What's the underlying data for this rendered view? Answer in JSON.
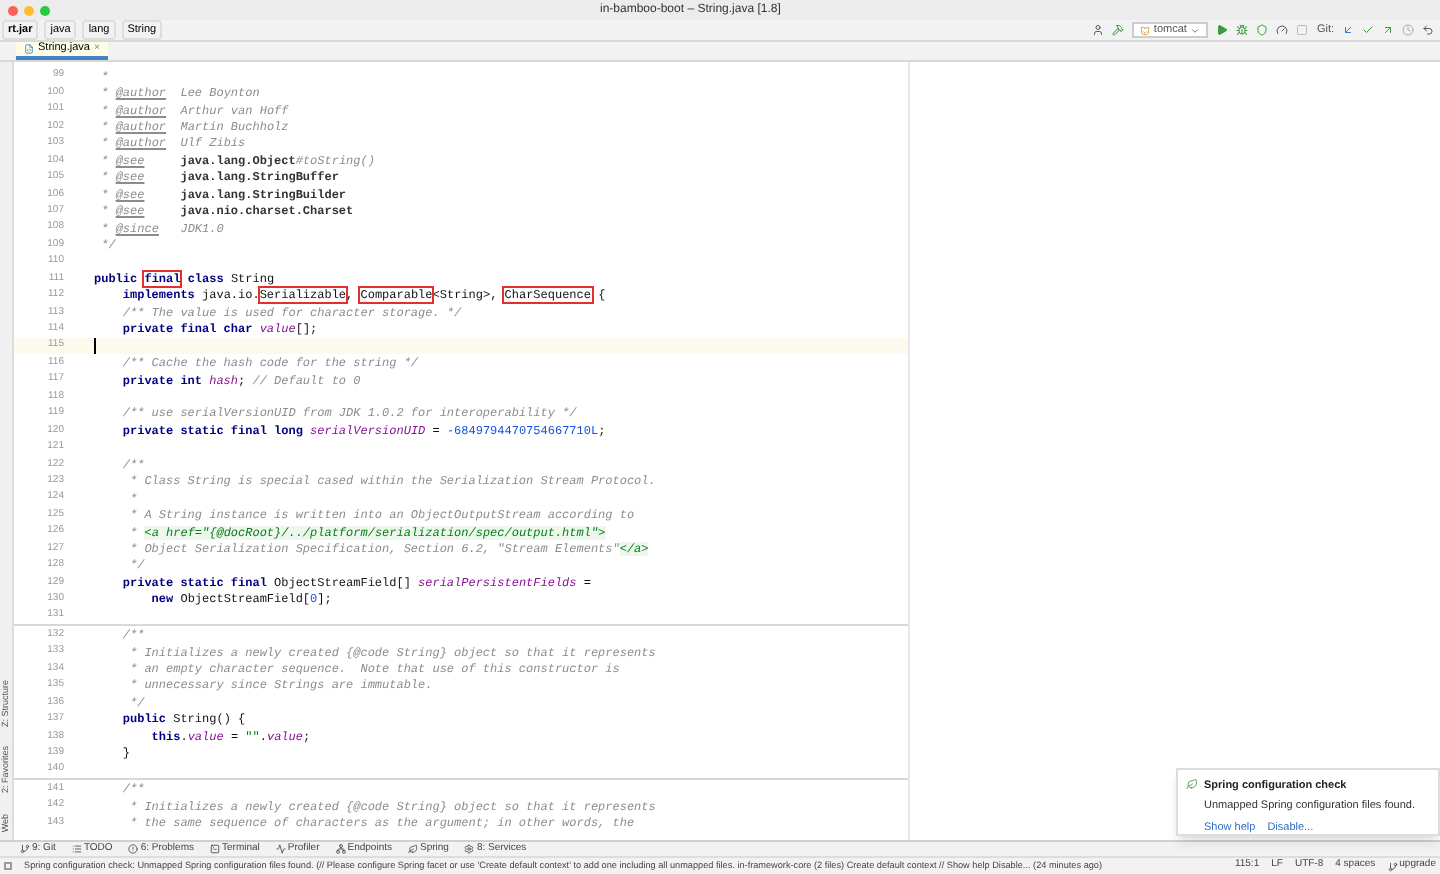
{
  "window": {
    "title": "in-bamboo-boot – String.java [1.8]"
  },
  "breadcrumbs": [
    "rt.jar",
    "java",
    "lang",
    "String"
  ],
  "toolbar": {
    "run_config": "tomcat",
    "git_label": "Git:"
  },
  "editor_tabs": [
    {
      "label": "String.java",
      "close": "×",
      "selected": true
    }
  ],
  "side_tabs": [
    "Z: Structure",
    "2: Favorites",
    "Web"
  ],
  "code": {
    "lines": [
      {
        "number": "99",
        "tokens": [
          {
            "kind": "cmt",
            "text": " *"
          }
        ]
      },
      {
        "number": "100",
        "tokens": [
          {
            "kind": "cmt",
            "text": " * "
          },
          {
            "kind": "tag",
            "text": "@author"
          },
          {
            "kind": "cmt",
            "text": "  Lee Boynton"
          }
        ]
      },
      {
        "number": "101",
        "tokens": [
          {
            "kind": "cmt",
            "text": " * "
          },
          {
            "kind": "tag",
            "text": "@author"
          },
          {
            "kind": "cmt",
            "text": "  Arthur van Hoff"
          }
        ]
      },
      {
        "number": "102",
        "tokens": [
          {
            "kind": "cmt",
            "text": " * "
          },
          {
            "kind": "tag",
            "text": "@author"
          },
          {
            "kind": "cmt",
            "text": "  Martin Buchholz"
          }
        ]
      },
      {
        "number": "103",
        "tokens": [
          {
            "kind": "cmt",
            "text": " * "
          },
          {
            "kind": "tag",
            "text": "@author"
          },
          {
            "kind": "cmt",
            "text": "  Ulf Zibis"
          }
        ]
      },
      {
        "number": "104",
        "tokens": [
          {
            "kind": "cmt",
            "text": " * "
          },
          {
            "kind": "tag",
            "text": "@see"
          },
          {
            "kind": "ref",
            "text": "     java.lang.Object"
          },
          {
            "kind": "cmt",
            "text": "#toString()"
          }
        ]
      },
      {
        "number": "105",
        "tokens": [
          {
            "kind": "cmt",
            "text": " * "
          },
          {
            "kind": "tag",
            "text": "@see"
          },
          {
            "kind": "ref",
            "text": "     java.lang.StringBuffer"
          }
        ]
      },
      {
        "number": "106",
        "tokens": [
          {
            "kind": "cmt",
            "text": " * "
          },
          {
            "kind": "tag",
            "text": "@see"
          },
          {
            "kind": "ref",
            "text": "     java.lang.StringBuilder"
          }
        ]
      },
      {
        "number": "107",
        "tokens": [
          {
            "kind": "cmt",
            "text": " * "
          },
          {
            "kind": "tag",
            "text": "@see"
          },
          {
            "kind": "ref",
            "text": "     java.nio.charset.Charset"
          }
        ]
      },
      {
        "number": "108",
        "tokens": [
          {
            "kind": "cmt",
            "text": " * "
          },
          {
            "kind": "tag",
            "text": "@since"
          },
          {
            "kind": "cmt",
            "text": "   JDK1.0"
          }
        ]
      },
      {
        "number": "109",
        "tokens": [
          {
            "kind": "cmt",
            "text": " */"
          }
        ]
      },
      {
        "number": "110"
      },
      {
        "number": "111",
        "tokens": [
          {
            "kind": "kw",
            "text": "public "
          },
          {
            "kind": "boxed-kw",
            "text": "final"
          },
          {
            "kind": "kw",
            "text": " class "
          },
          {
            "kind": "plain",
            "text": "String"
          }
        ]
      },
      {
        "number": "112",
        "tokens": [
          {
            "kind": "kw",
            "text": "    implements "
          },
          {
            "kind": "plain",
            "text": "java.io."
          },
          {
            "kind": "boxed",
            "text": "Serializable"
          },
          {
            "kind": "plain",
            "text": ", "
          },
          {
            "kind": "boxed",
            "text": "Comparable"
          },
          {
            "kind": "plain",
            "text": "<String>, "
          },
          {
            "kind": "boxed",
            "text": "CharSequence"
          },
          {
            "kind": "plain",
            "text": " {"
          }
        ]
      },
      {
        "number": "113",
        "tokens": [
          {
            "kind": "cmt",
            "text": "    /** The value is used for character storage. */"
          }
        ]
      },
      {
        "number": "114",
        "tokens": [
          {
            "kind": "kw",
            "text": "    private final char "
          },
          {
            "kind": "field",
            "text": "value"
          },
          {
            "kind": "plain",
            "text": "[];"
          }
        ]
      },
      {
        "number": "115",
        "current": true
      },
      {
        "number": "116",
        "tokens": [
          {
            "kind": "cmt",
            "text": "    /** Cache the hash code for the string */"
          }
        ]
      },
      {
        "number": "117",
        "tokens": [
          {
            "kind": "kw",
            "text": "    private int "
          },
          {
            "kind": "field",
            "text": "hash"
          },
          {
            "kind": "plain",
            "text": "; "
          },
          {
            "kind": "cmt",
            "text": "// Default to 0"
          }
        ]
      },
      {
        "number": "118"
      },
      {
        "number": "119",
        "tokens": [
          {
            "kind": "cmt",
            "text": "    /** use serialVersionUID from JDK 1.0.2 for interoperability */"
          }
        ]
      },
      {
        "number": "120",
        "tokens": [
          {
            "kind": "kw",
            "text": "    private static final long "
          },
          {
            "kind": "field",
            "text": "serialVersionUID"
          },
          {
            "kind": "plain",
            "text": " = "
          },
          {
            "kind": "num",
            "text": "-6849794470754667710L"
          },
          {
            "kind": "plain",
            "text": ";"
          }
        ]
      },
      {
        "number": "121"
      },
      {
        "number": "122",
        "tokens": [
          {
            "kind": "cmt",
            "text": "    /**"
          }
        ]
      },
      {
        "number": "123",
        "tokens": [
          {
            "kind": "cmt",
            "text": "     * Class String is special cased within the Serialization Stream Protocol."
          }
        ]
      },
      {
        "number": "124",
        "tokens": [
          {
            "kind": "cmt",
            "text": "     *"
          }
        ]
      },
      {
        "number": "125",
        "tokens": [
          {
            "kind": "cmt",
            "text": "     * A String instance is written into an ObjectOutputStream according to"
          }
        ]
      },
      {
        "number": "126",
        "tokens": [
          {
            "kind": "cmt",
            "text": "     * "
          },
          {
            "kind": "html",
            "text": "<a href=\"{@docRoot}/../platform/serialization/spec/output.html\">"
          }
        ]
      },
      {
        "number": "127",
        "tokens": [
          {
            "kind": "cmt",
            "text": "     * Object Serialization Specification, Section 6.2, \"Stream Elements\""
          },
          {
            "kind": "html",
            "text": "</a>"
          }
        ]
      },
      {
        "number": "128",
        "tokens": [
          {
            "kind": "cmt",
            "text": "     */"
          }
        ]
      },
      {
        "number": "129",
        "tokens": [
          {
            "kind": "kw",
            "text": "    private static final "
          },
          {
            "kind": "plain",
            "text": "ObjectStreamField[] "
          },
          {
            "kind": "field",
            "text": "serialPersistentFields"
          },
          {
            "kind": "plain",
            "text": " ="
          }
        ]
      },
      {
        "number": "130",
        "tokens": [
          {
            "kind": "kw",
            "text": "        new "
          },
          {
            "kind": "plain",
            "text": "ObjectStreamField["
          },
          {
            "kind": "num",
            "text": "0"
          },
          {
            "kind": "plain",
            "text": "];"
          }
        ]
      },
      {
        "number": "131"
      },
      {
        "number": "132",
        "divider": true,
        "tokens": [
          {
            "kind": "cmt",
            "text": "    /**"
          }
        ]
      },
      {
        "number": "133",
        "tokens": [
          {
            "kind": "cmt",
            "text": "     * Initializes a newly created {@code String} object so that it represents"
          }
        ]
      },
      {
        "number": "134",
        "tokens": [
          {
            "kind": "cmt",
            "text": "     * an empty character sequence.  Note that use of this constructor is"
          }
        ]
      },
      {
        "number": "135",
        "tokens": [
          {
            "kind": "cmt",
            "text": "     * unnecessary since Strings are immutable."
          }
        ]
      },
      {
        "number": "136",
        "tokens": [
          {
            "kind": "cmt",
            "text": "     */"
          }
        ]
      },
      {
        "number": "137",
        "tokens": [
          {
            "kind": "kw",
            "text": "    public "
          },
          {
            "kind": "plain",
            "text": "String() {"
          }
        ]
      },
      {
        "number": "138",
        "tokens": [
          {
            "kind": "kw",
            "text": "        this"
          },
          {
            "kind": "plain",
            "text": "."
          },
          {
            "kind": "field",
            "text": "value"
          },
          {
            "kind": "plain",
            "text": " = "
          },
          {
            "kind": "str",
            "text": "\"\""
          },
          {
            "kind": "plain",
            "text": "."
          },
          {
            "kind": "field",
            "text": "value"
          },
          {
            "kind": "plain",
            "text": ";"
          }
        ]
      },
      {
        "number": "139",
        "tokens": [
          {
            "kind": "plain",
            "text": "    }"
          }
        ]
      },
      {
        "number": "140"
      },
      {
        "number": "141",
        "divider": true,
        "tokens": [
          {
            "kind": "cmt",
            "text": "    /**"
          }
        ]
      },
      {
        "number": "142",
        "tokens": [
          {
            "kind": "cmt",
            "text": "     * Initializes a newly created {@code String} object so that it represents"
          }
        ]
      },
      {
        "number": "143",
        "tokens": [
          {
            "kind": "cmt",
            "text": "     * the same sequence of characters as the argument; in other words, the"
          }
        ]
      }
    ]
  },
  "tool_windows": [
    "9: Git",
    "TODO",
    "6: Problems",
    "Terminal",
    "Profiler",
    "Endpoints",
    "Spring",
    "8: Services"
  ],
  "notification": {
    "title": "Spring configuration check",
    "message": "Unmapped Spring configuration files found.",
    "links": [
      "Show help",
      "Disable..."
    ]
  },
  "status_bar": {
    "message": "Spring configuration check: Unmapped Spring configuration files found. (// Please configure Spring facet or use 'Create default context' to add one including all unmapped files. in-framework-core (2 files)  Create default context // Show help  Disable... (24 minutes ago)",
    "position": "115:1",
    "line_ending": "LF",
    "encoding": "UTF-8",
    "indent": "4 spaces",
    "branch": "upgrade"
  }
}
